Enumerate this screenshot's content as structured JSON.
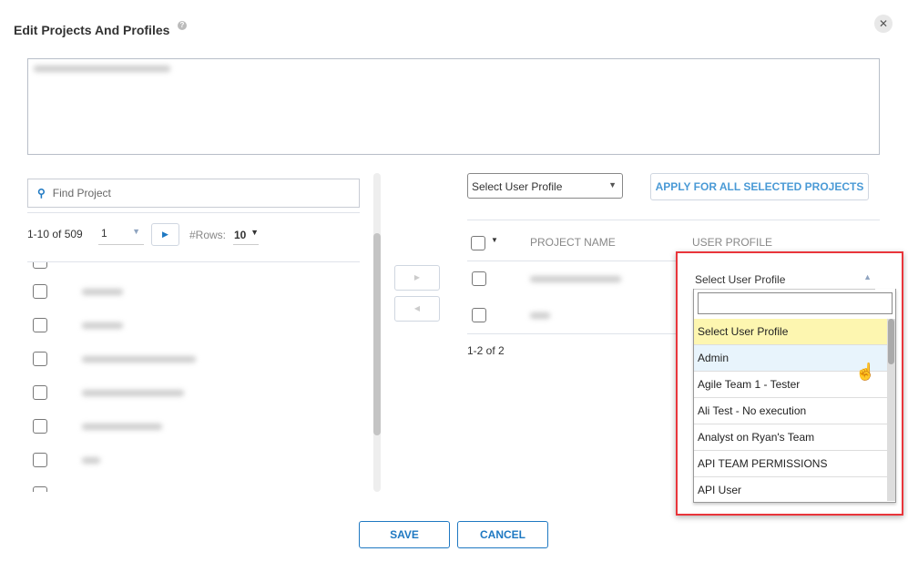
{
  "dialog": {
    "title": "Edit Projects And Profiles",
    "help_icon": "question-circle-icon",
    "close_icon": "close-icon"
  },
  "left": {
    "search_placeholder": "Find Project",
    "range": "1-10 of 509",
    "page": "1",
    "rows_label": "#Rows:",
    "rows_value": "10"
  },
  "right": {
    "profile_select": "Select User Profile",
    "apply_label": "APPLY FOR ALL SELECTED PROJECTS",
    "col_project": "PROJECT NAME",
    "col_profile": "USER PROFILE",
    "range": "1-2 of 2"
  },
  "profile_dropdown": {
    "selected": "Select User Profile",
    "search_value": "",
    "options": [
      "Select User Profile",
      "Admin",
      "Agile Team 1 - Tester",
      "Ali Test - No execution",
      "Analyst on Ryan's Team",
      "API TEAM PERMISSIONS",
      "API User"
    ],
    "highlight_color": "#fdf6b0",
    "hover_color": "#e8f4fc"
  },
  "footer": {
    "save": "SAVE",
    "cancel": "CANCEL"
  },
  "colors": {
    "accent": "#1e78c2",
    "highlight_border": "#e9353b"
  }
}
